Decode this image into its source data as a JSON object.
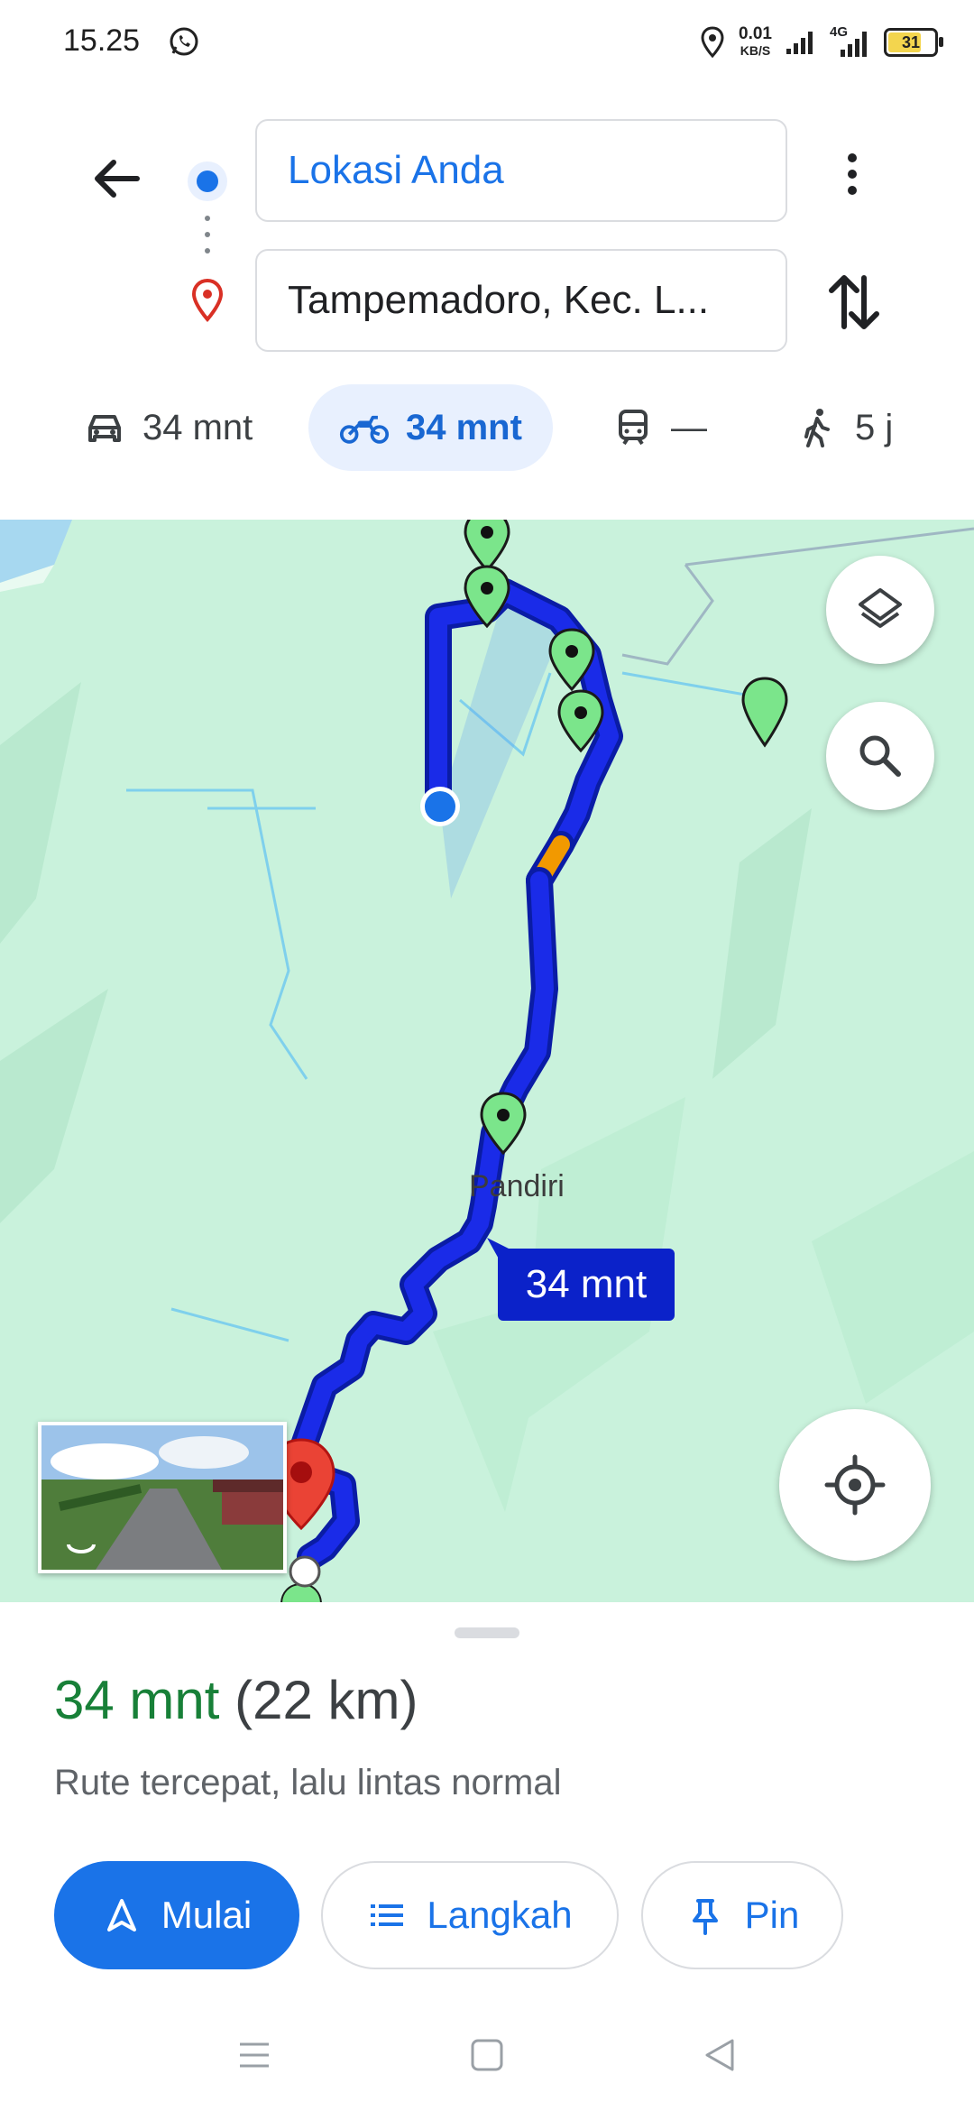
{
  "status_bar": {
    "time": "15.25",
    "speed_value": "0.01",
    "speed_unit": "KB/S",
    "network": "4G",
    "battery": "31",
    "icons": [
      "whatsapp-icon",
      "location-icon",
      "signal-icon",
      "signal-4g-icon",
      "battery-icon"
    ]
  },
  "header": {
    "origin": "Lokasi Anda",
    "destination": "Tampemadoro, Kec. L...",
    "modes": [
      {
        "name": "car",
        "label": "34 mnt",
        "icon": "car-icon"
      },
      {
        "name": "motorcycle",
        "label": "34 mnt",
        "icon": "motorcycle-icon",
        "selected": true
      },
      {
        "name": "transit",
        "label": "—",
        "icon": "train-icon"
      },
      {
        "name": "walk",
        "label": "5 j",
        "icon": "walk-icon"
      }
    ]
  },
  "map": {
    "town_label": "Pandiri",
    "eta_label": "34 mnt",
    "colors": {
      "land": "#c9f2dc",
      "route": "#1a2be8",
      "traffic": "#f29900",
      "water": "#a7d8f0",
      "destination": "#ea4335"
    }
  },
  "sheet": {
    "duration": "34 mnt",
    "distance": "(22 km)",
    "description": "Rute tercepat, lalu lintas normal",
    "start_label": "Mulai",
    "steps_label": "Langkah",
    "pin_label": "Pin"
  },
  "accent": "#1a73e8"
}
